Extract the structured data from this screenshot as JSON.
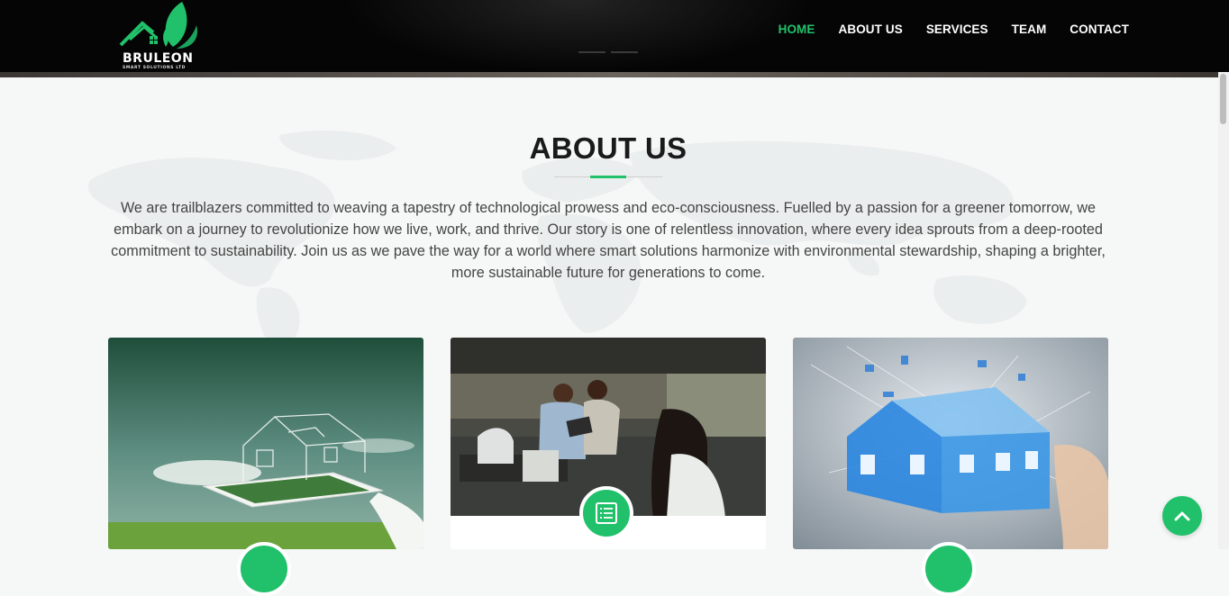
{
  "brand": {
    "name": "BRULEON",
    "tagline": "SMART SOLUTIONS LTD",
    "accent_color": "#21c16b"
  },
  "nav": {
    "items": [
      {
        "label": "HOME",
        "active": true
      },
      {
        "label": "ABOUT US",
        "active": false
      },
      {
        "label": "SERVICES",
        "active": false
      },
      {
        "label": "TEAM",
        "active": false
      },
      {
        "label": "CONTACT",
        "active": false
      }
    ]
  },
  "about": {
    "title": "ABOUT US",
    "body": "We are trailblazers committed to weaving a tapestry of technological prowess and eco-consciousness. Fuelled by a passion for a greener tomorrow, we embark on a journey to revolutionize how we live, work, and thrive. Our story is one of relentless innovation, where every idea sprouts from a deep-rooted commitment to sustainability. Join us as we pave the way for a world where smart solutions harmonize with environmental stewardship, shaping a brighter, more sustainable future for generations to come."
  },
  "cards": [
    {
      "image": "holographic-house-on-tablet",
      "icon": "badge-icon"
    },
    {
      "image": "team-in-office",
      "icon": "list-icon"
    },
    {
      "image": "smart-home-network",
      "icon": "badge-icon"
    }
  ],
  "icons": {
    "back_to_top": "chevron-up-icon"
  }
}
